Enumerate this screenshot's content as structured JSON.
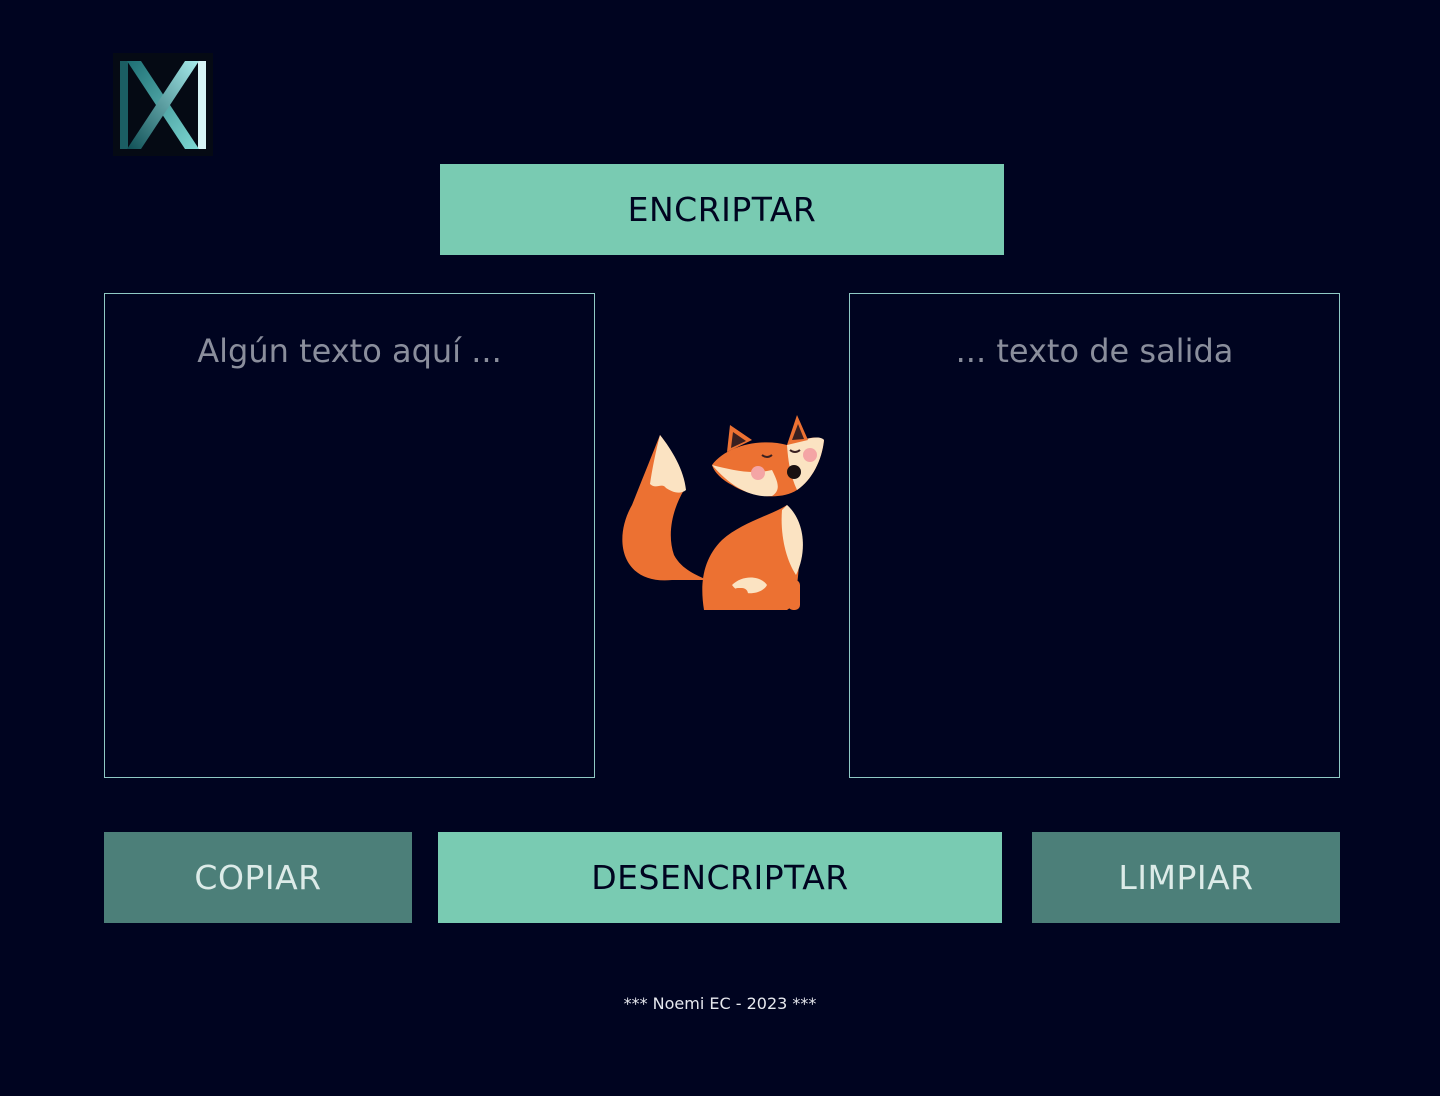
{
  "logo": {
    "icon": "letter-x-logo-icon"
  },
  "buttons": {
    "encrypt_label": "ENCRIPTAR",
    "copy_label": "COPIAR",
    "decrypt_label": "DESENCRIPTAR",
    "clear_label": "LIMPIAR"
  },
  "input": {
    "placeholder": "Algún texto aquí ...",
    "value": ""
  },
  "output": {
    "placeholder": "... texto de salida",
    "value": ""
  },
  "illustration": {
    "icon": "fox-icon"
  },
  "footer": {
    "text": "*** Noemi EC - 2023 ***"
  },
  "colors": {
    "background": "#000420",
    "primary_button": "#79cbb2",
    "secondary_button": "#4c7f79",
    "textbox_border": "#8fc9c4"
  }
}
